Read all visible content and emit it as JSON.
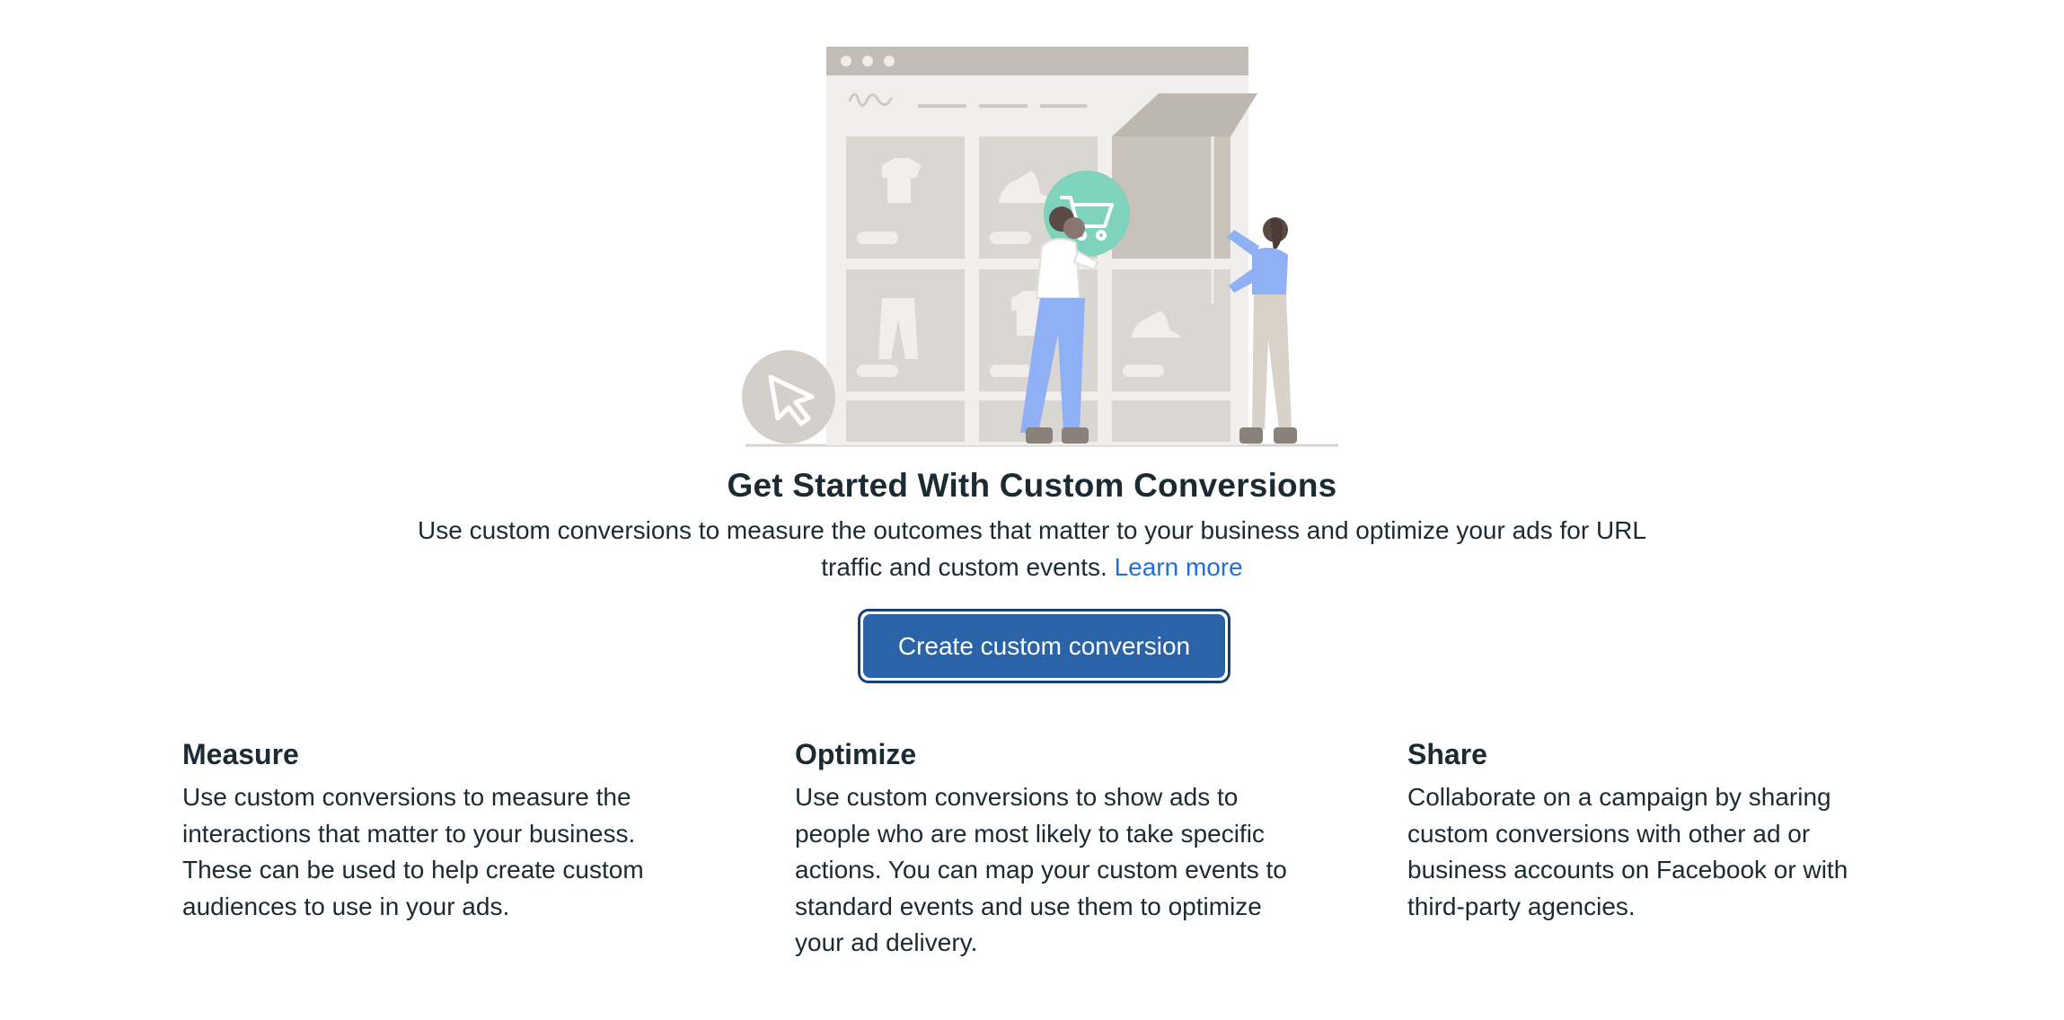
{
  "hero": {
    "title": "Get Started With Custom Conversions",
    "description_text": "Use custom conversions to measure the outcomes that matter to your business and optimize your ads for URL traffic and custom events.",
    "learn_more_label": "Learn more",
    "cta_label": "Create custom conversion"
  },
  "features": [
    {
      "title": "Measure",
      "body": "Use custom conversions to measure the interactions that matter to your business. These can be used to help create custom audiences to use in your ads."
    },
    {
      "title": "Optimize",
      "body": "Use custom conversions to show ads to people who are most likely to take specific actions. You can map your custom events to standard events and use them to optimize your ad delivery."
    },
    {
      "title": "Share",
      "body": "Collaborate on a campaign by sharing custom conversions with other ad or business accounts on Facebook or with third-party agencies."
    }
  ],
  "colors": {
    "primary_button": "#2a63a7",
    "link": "#216fdb",
    "text": "#1c2b33",
    "accent_teal": "#7fd3bd",
    "accent_blue": "#8fb0f5"
  },
  "icons": {
    "cart": "shopping-cart-icon",
    "cursor": "cursor-pointer-icon"
  }
}
